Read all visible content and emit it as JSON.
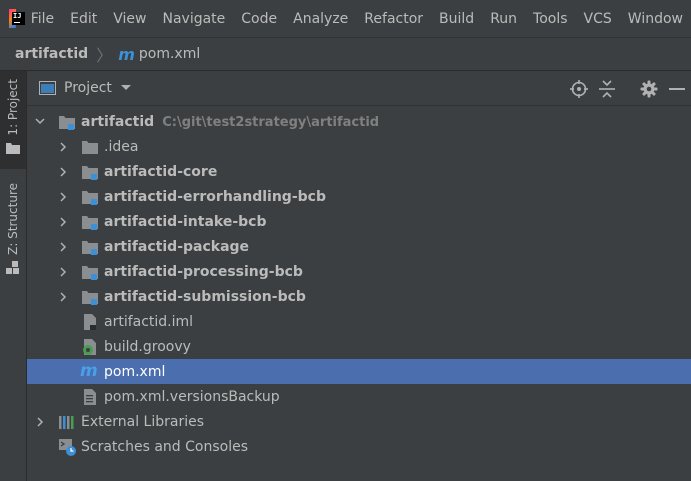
{
  "menu": [
    "File",
    "Edit",
    "View",
    "Navigate",
    "Code",
    "Analyze",
    "Refactor",
    "Build",
    "Run",
    "Tools",
    "VCS",
    "Window"
  ],
  "breadcrumb": {
    "root": "artifactid",
    "file": "pom.xml"
  },
  "sidebar": {
    "project_tab": "1: Project",
    "structure_tab": "Z: Structure"
  },
  "panel": {
    "title": "Project"
  },
  "tree": {
    "root": {
      "label": "artifactid",
      "path": "C:\\git\\test2strategy\\artifactid"
    },
    "items": [
      {
        "label": ".idea"
      },
      {
        "label": "artifactid-core"
      },
      {
        "label": "artifactid-errorhandling-bcb"
      },
      {
        "label": "artifactid-intake-bcb"
      },
      {
        "label": "artifactid-package"
      },
      {
        "label": "artifactid-processing-bcb"
      },
      {
        "label": "artifactid-submission-bcb"
      },
      {
        "label": "artifactid.iml"
      },
      {
        "label": "build.groovy"
      },
      {
        "label": "pom.xml"
      },
      {
        "label": "pom.xml.versionsBackup"
      },
      {
        "label": "External Libraries"
      },
      {
        "label": "Scratches and Consoles"
      }
    ]
  },
  "colors": {
    "selection": "#4b6eaf",
    "background": "#3c3f41",
    "accent_blue": "#3d8fd6"
  }
}
